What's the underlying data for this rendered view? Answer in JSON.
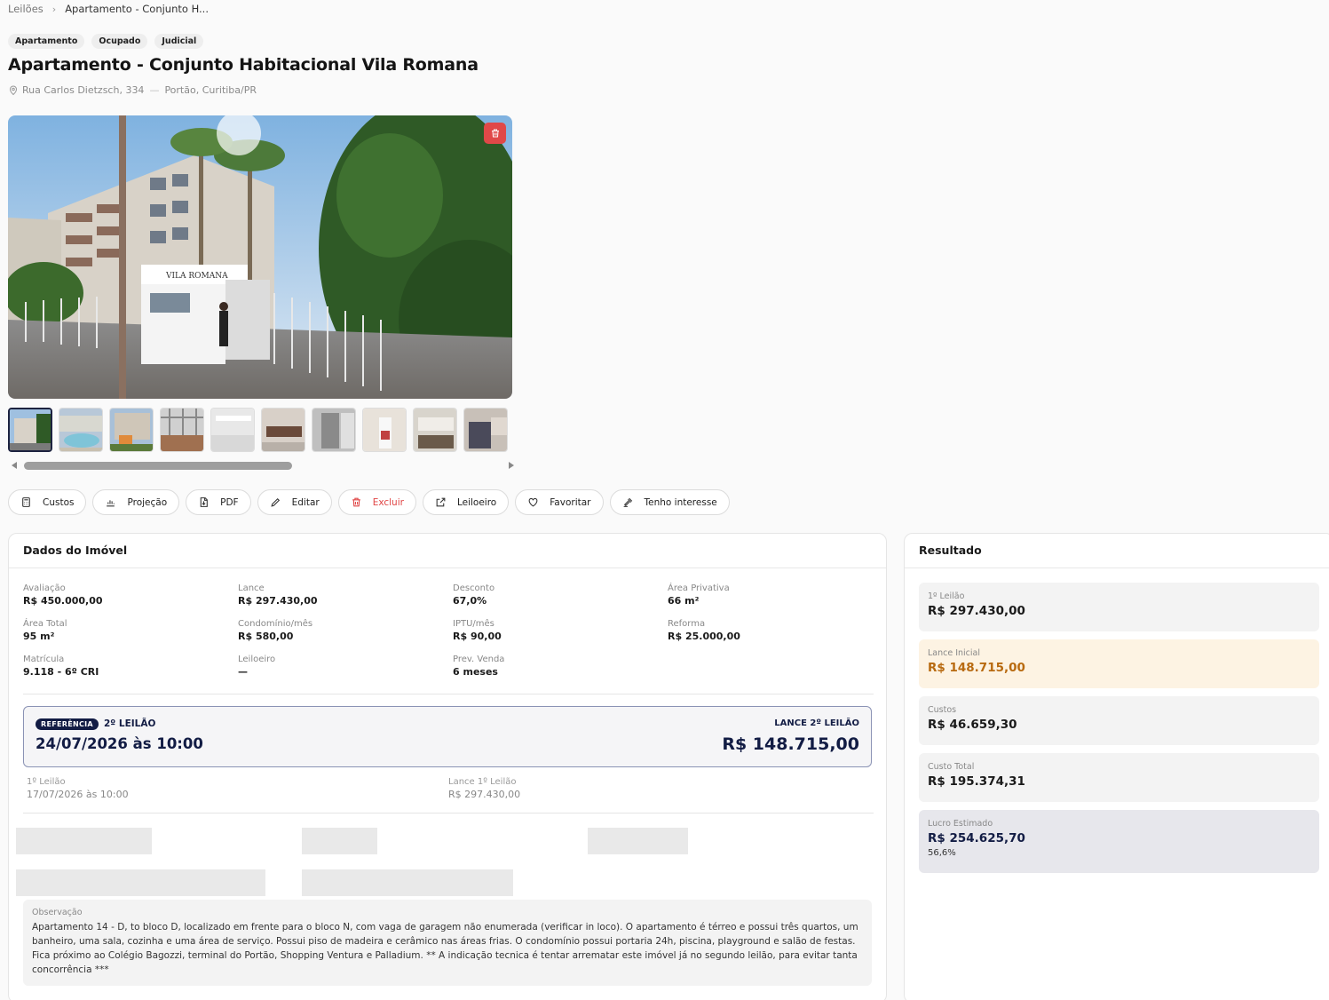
{
  "breadcrumb": {
    "root": "Leilões",
    "current": "Apartamento - Conjunto H..."
  },
  "tags": [
    "Apartamento",
    "Ocupado",
    "Judicial"
  ],
  "title": "Apartamento - Conjunto Habitacional Vila Romana",
  "address": {
    "street": "Rua Carlos Dietzsch, 334",
    "district": "Portão, Curitiba/PR"
  },
  "photo": {
    "sign_text": "VILA ROMANA"
  },
  "actions": [
    "Custos",
    "Projeção",
    "PDF",
    "Editar",
    "Excluir",
    "Leiloeiro",
    "Favoritar",
    "Tenho interesse"
  ],
  "dados": {
    "title": "Dados do Imóvel",
    "fields": [
      {
        "label": "Avaliação",
        "value": "R$ 450.000,00"
      },
      {
        "label": "Lance",
        "value": "R$ 297.430,00"
      },
      {
        "label": "Desconto",
        "value": "67,0%"
      },
      {
        "label": "Área Privativa",
        "value": "66 m²"
      },
      {
        "label": "Área Total",
        "value": "95 m²"
      },
      {
        "label": "Condomínio/mês",
        "value": "R$ 580,00"
      },
      {
        "label": "IPTU/mês",
        "value": "R$ 90,00"
      },
      {
        "label": "Reforma",
        "value": "R$ 25.000,00"
      },
      {
        "label": "Matrícula",
        "value": "9.118 - 6º CRI"
      },
      {
        "label": "Leiloeiro",
        "value": "—"
      },
      {
        "label": "Prev. Venda",
        "value": "6 meses"
      }
    ],
    "referencia": {
      "badge": "REFERÊNCIA",
      "leilao": "2º LEILÃO",
      "date": "24/07/2026 às 10:00",
      "lance_label": "LANCE 2º LEILÃO",
      "lance_value": "R$ 148.715,00"
    },
    "primeiro": [
      {
        "label": "1º Leilão",
        "value": "17/07/2026 às 10:00"
      },
      {
        "label": "Lance 1º Leilão",
        "value": "R$ 297.430,00"
      }
    ],
    "observacao": {
      "label": "Observação",
      "text": "Apartamento 14 - D, to bloco D, localizado em frente para o bloco N, com vaga de garagem não enumerada (verificar in loco). O apartamento é térreo e possui três quartos, um banheiro, uma sala, cozinha e uma área de serviço. Possui piso de madeira e cerâmico nas áreas frias. O condomínio possui portaria 24h, piscina, playground e salão de festas. Fica próximo ao Colégio Bagozzi, terminal do Portão, Shopping Ventura e Palladium. ** A indicação tecnica é tentar arrematar este imóvel já no segundo leilão, para evitar tanta concorrência ***"
    }
  },
  "resultado": {
    "title": "Resultado",
    "items": [
      {
        "label": "1º Leilão",
        "value": "R$ 297.430,00"
      },
      {
        "label": "Lance Inicial",
        "value": "R$ 148.715,00"
      },
      {
        "label": "Custos",
        "value": "R$ 46.659,30"
      },
      {
        "label": "Custo Total",
        "value": "R$ 195.374,31"
      },
      {
        "label": "Lucro Estimado",
        "value": "R$ 254.625,70",
        "percent": "56,6%"
      }
    ]
  },
  "colors": {
    "navy": "#121c44",
    "danger": "#e04848",
    "highlight_bg": "#fdf3e3",
    "highlight_text": "#b86a10"
  }
}
